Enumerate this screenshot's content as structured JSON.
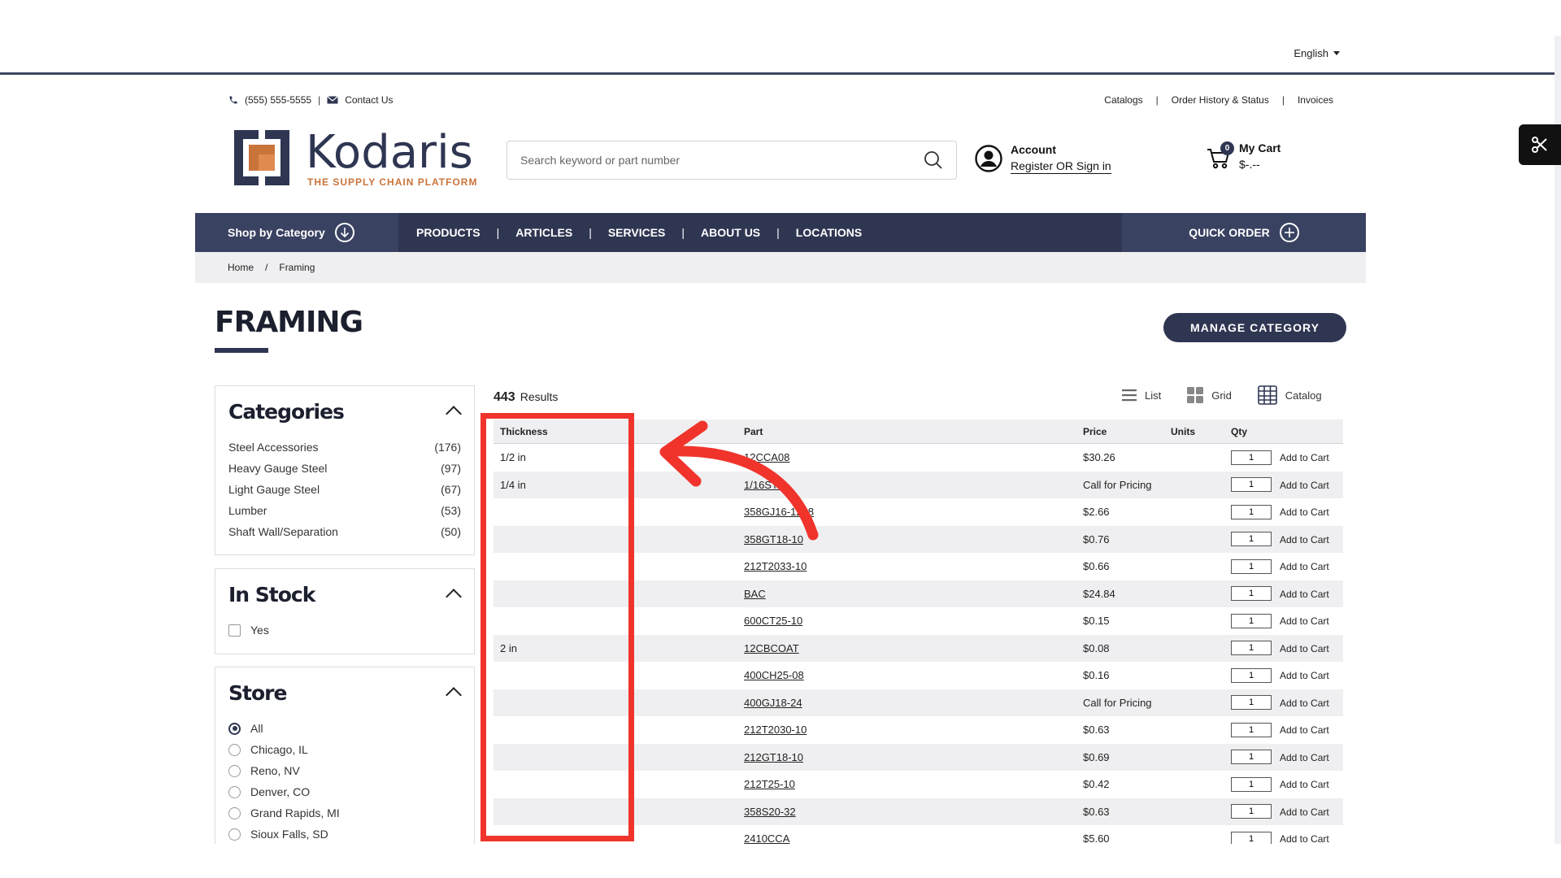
{
  "language": {
    "selected": "English"
  },
  "utility": {
    "phone": "(555) 555-5555",
    "contact": "Contact Us",
    "links": [
      "Catalogs",
      "Order History & Status",
      "Invoices"
    ]
  },
  "brand": {
    "name": "Kodaris",
    "tagline": "THE SUPPLY CHAIN PLATFORM",
    "color_primary": "#2f3652",
    "color_accent": "#c9743b"
  },
  "search": {
    "placeholder": "Search keyword or part number"
  },
  "account": {
    "title": "Account",
    "link": "Register OR Sign in"
  },
  "cart": {
    "title": "My Cart",
    "total": "$-.--",
    "count": "0"
  },
  "nav": {
    "shop": "Shop by Category",
    "items": [
      "PRODUCTS",
      "ARTICLES",
      "SERVICES",
      "ABOUT US",
      "LOCATIONS"
    ],
    "quick": "QUICK ORDER"
  },
  "breadcrumb": {
    "home": "Home",
    "sep": "/",
    "current": "Framing"
  },
  "page": {
    "title": "FRAMING",
    "manage_button": "MANAGE CATEGORY"
  },
  "facets": {
    "categories": {
      "title": "Categories",
      "items": [
        {
          "label": "Steel Accessories",
          "count": "(176)"
        },
        {
          "label": "Heavy Gauge Steel",
          "count": "(97)"
        },
        {
          "label": "Light Gauge Steel",
          "count": "(67)"
        },
        {
          "label": "Lumber",
          "count": "(53)"
        },
        {
          "label": "Shaft Wall/Separation",
          "count": "(50)"
        }
      ]
    },
    "in_stock": {
      "title": "In Stock",
      "option": "Yes"
    },
    "store": {
      "title": "Store",
      "options": [
        "All",
        "Chicago, IL",
        "Reno, NV",
        "Denver, CO",
        "Grand Rapids, MI",
        "Sioux Falls, SD"
      ],
      "selected": "All"
    }
  },
  "results": {
    "count": "443",
    "label": "Results",
    "views": [
      "List",
      "Grid",
      "Catalog"
    ],
    "columns": [
      "Thickness",
      "Part",
      "Price",
      "Units",
      "Qty",
      ""
    ],
    "add_label": "Add to Cart",
    "rows": [
      {
        "thickness": "1/2 in",
        "part": "12CCA08",
        "price": "$30.26",
        "qty": "1"
      },
      {
        "thickness": "1/4 in",
        "part": "1/16STR",
        "price": "Call for Pricing",
        "qty": "1"
      },
      {
        "thickness": "",
        "part": "358GJ16-1208",
        "price": "$2.66",
        "qty": "1"
      },
      {
        "thickness": "",
        "part": "358GT18-10",
        "price": "$0.76",
        "qty": "1"
      },
      {
        "thickness": "",
        "part": "212T2033-10",
        "price": "$0.66",
        "qty": "1"
      },
      {
        "thickness": "",
        "part": "BAC",
        "price": "$24.84",
        "qty": "1"
      },
      {
        "thickness": "",
        "part": "600CT25-10",
        "price": "$0.15",
        "qty": "1"
      },
      {
        "thickness": "2 in",
        "part": "12CBCOAT",
        "price": "$0.08",
        "qty": "1"
      },
      {
        "thickness": "",
        "part": "400CH25-08",
        "price": "$0.16",
        "qty": "1"
      },
      {
        "thickness": "",
        "part": "400GJ18-24",
        "price": "Call for Pricing",
        "qty": "1"
      },
      {
        "thickness": "",
        "part": "212T2030-10",
        "price": "$0.63",
        "qty": "1"
      },
      {
        "thickness": "",
        "part": "212GT18-10",
        "price": "$0.69",
        "qty": "1"
      },
      {
        "thickness": "",
        "part": "212T25-10",
        "price": "$0.42",
        "qty": "1"
      },
      {
        "thickness": "",
        "part": "358S20-32",
        "price": "$0.63",
        "qty": "1"
      },
      {
        "thickness": "",
        "part": "2410CCA",
        "price": "$5.60",
        "qty": "1"
      }
    ]
  },
  "annotation": {
    "color": "#f0342c"
  }
}
